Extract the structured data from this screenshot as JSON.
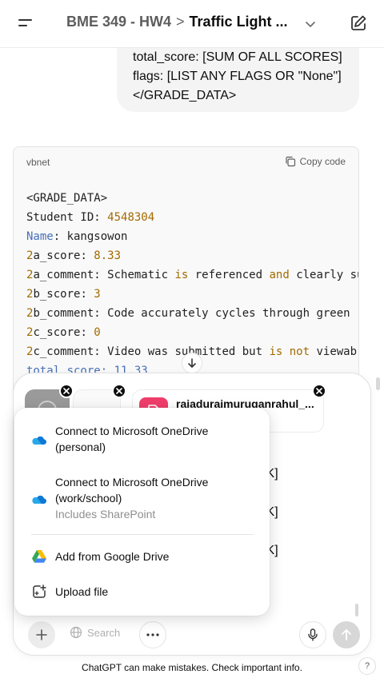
{
  "header": {
    "project": "BME 349 - HW4",
    "separator": ">",
    "conversation_title": "Traffic Light ..."
  },
  "message": {
    "lines": [
      "total_score: [SUM OF ALL SCORES]",
      "flags: [LIST ANY FLAGS OR \"None\"]",
      "</GRADE_DATA>"
    ]
  },
  "code": {
    "language": "vbnet",
    "copy_label": "Copy code",
    "lines": [
      "<GRADE_DATA>",
      "Student ID: 4548304",
      "Name: kangsowon",
      "2a_score: 8.33",
      "2a_comment: Schematic is referenced and clearly su",
      "2b_score: 3",
      "2b_comment: Code accurately cycles through green",
      "2c_score: 0",
      "2c_comment: Video was submitted but is not viewab",
      "total_score: 11.33"
    ]
  },
  "composer": {
    "attachment_file_name": "rajaduraimuruganrahul_...",
    "bracket_fragments": [
      "CK]",
      "CK]",
      "CK]"
    ],
    "search_label": "Search"
  },
  "menu": {
    "items": [
      {
        "label_line1": "Connect to Microsoft OneDrive",
        "label_line2": "(personal)"
      },
      {
        "label_line1": "Connect to Microsoft OneDrive",
        "label_line2": "(work/school)",
        "sub": "Includes SharePoint"
      },
      {
        "label": "Add from Google Drive"
      },
      {
        "label": "Upload file"
      }
    ]
  },
  "footer": {
    "disclaimer": "ChatGPT can make mistakes. Check important info.",
    "help": "?"
  },
  "colors": {
    "onedrive_blue": "#0f78d4",
    "file_icon_pink": "#f03e6b",
    "code_number": "#a26b00",
    "code_name": "#4670b8"
  },
  "icons": [
    "hamburger-icon",
    "chevron-down-icon",
    "edit-icon",
    "copy-icon",
    "arrow-down-icon",
    "close-icon",
    "document-icon",
    "onedrive-icon",
    "google-drive-icon",
    "upload-file-icon",
    "plus-icon",
    "globe-icon",
    "ellipsis-icon",
    "microphone-icon",
    "arrow-up-icon"
  ]
}
